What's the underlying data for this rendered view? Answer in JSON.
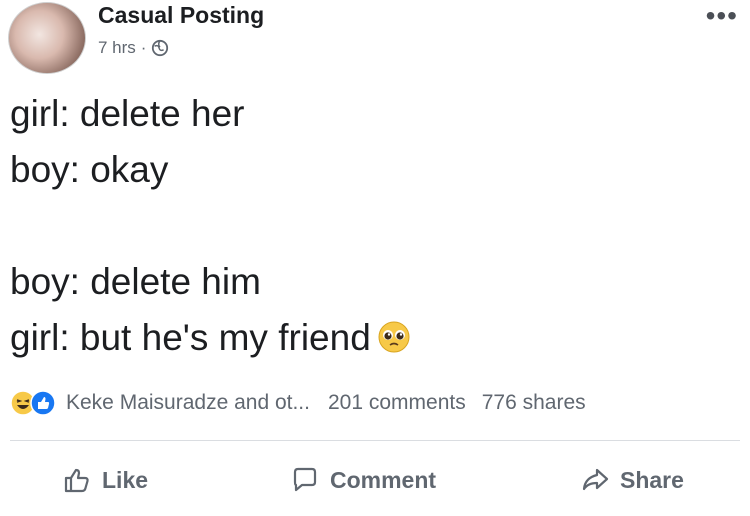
{
  "post": {
    "author": "Casual Posting",
    "time": "7 hrs",
    "separator": "·",
    "privacy_icon": "globe-icon",
    "more_icon": "more-options-icon",
    "more_label": "•••"
  },
  "content": {
    "lines": [
      "girl: delete her",
      "boy: okay",
      "",
      "boy: delete him",
      "girl: but he's my friend"
    ],
    "trailing_emoji": "pleading-face-emoji"
  },
  "stats": {
    "reaction_icons": [
      "haha-reaction-icon",
      "like-reaction-icon"
    ],
    "reactors": "Keke Maisuradze and ot...",
    "comments": "201 comments",
    "shares": "776 shares"
  },
  "actions": {
    "like": "Like",
    "comment": "Comment",
    "share": "Share"
  },
  "colors": {
    "text": "#1c1e21",
    "secondary": "#606770",
    "like_blue": "#1877f2",
    "haha_yellow": "#f7c948"
  }
}
